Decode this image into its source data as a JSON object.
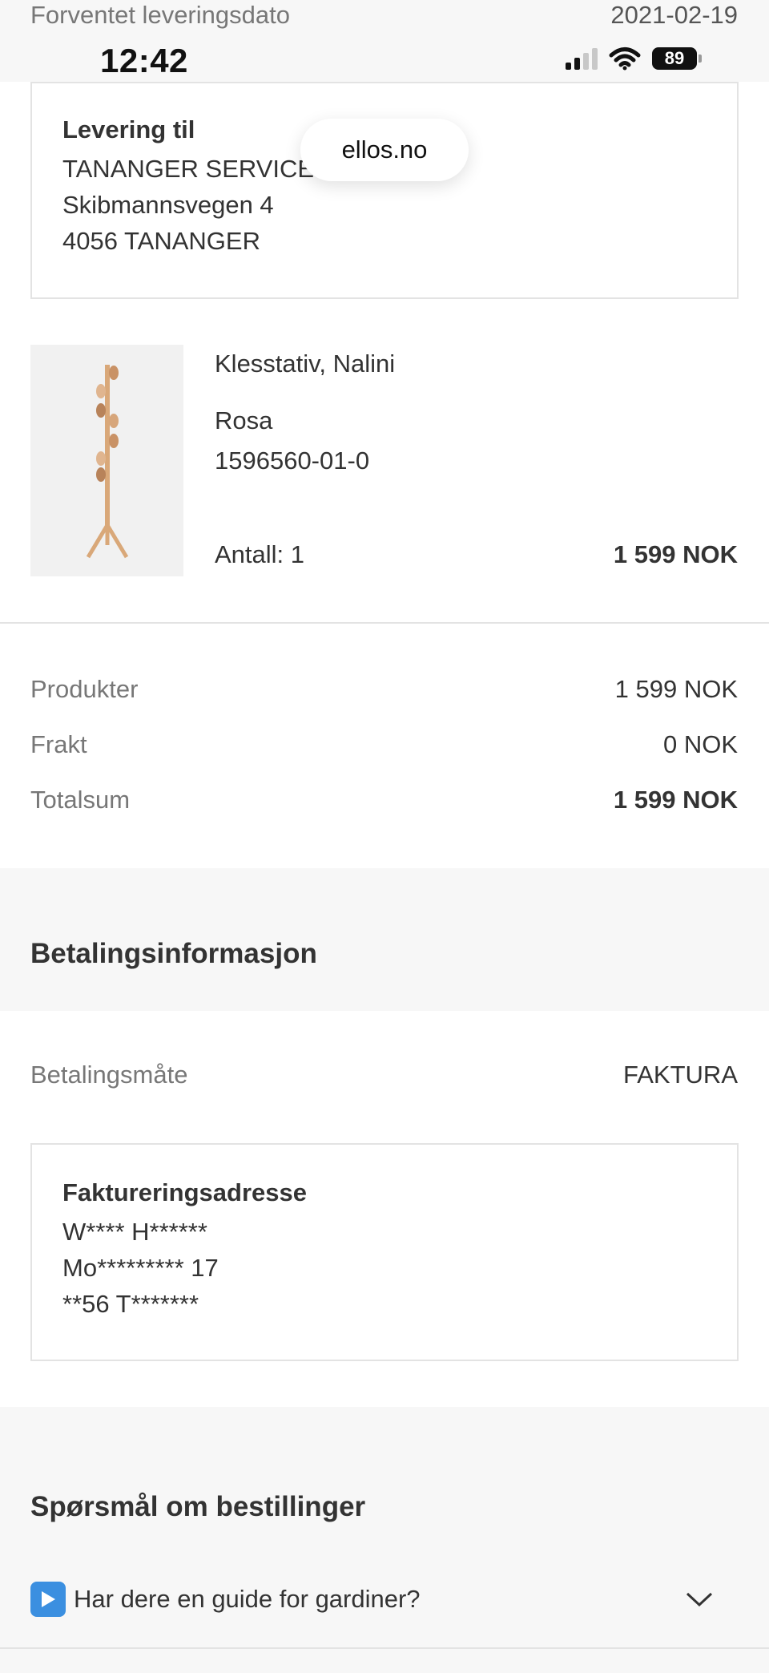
{
  "status_bar": {
    "time": "12:42",
    "battery": "89"
  },
  "delivery": {
    "date_label": "Forventet leveringsdato",
    "date_value": "2021-02-19"
  },
  "browser": {
    "domain": "ellos.no"
  },
  "shipping_address": {
    "heading": "Levering til",
    "lines": [
      "TANANGER SERVICE SENTER",
      "Skibmannsvegen 4",
      "4056 TANANGER"
    ]
  },
  "product": {
    "name": "Klesstativ, Nalini",
    "color": "Rosa",
    "sku": "1596560-01-0",
    "quantity": "Antall: 1",
    "price": "1 599 NOK",
    "image": "coat-rack-image"
  },
  "summary": [
    {
      "label": "Produkter",
      "value": "1 599 NOK"
    },
    {
      "label": "Frakt",
      "value": "0 NOK"
    },
    {
      "label": "Totalsum",
      "value": "1 599 NOK"
    }
  ],
  "payment": {
    "heading": "Betalingsinformasjon",
    "method_label": "Betalingsmåte",
    "method_value": "FAKTURA"
  },
  "billing_address": {
    "heading": "Faktureringsadresse",
    "lines": [
      "W**** H******",
      "Mo********* 17",
      "**56 T*******"
    ]
  },
  "faq": {
    "heading": "Spørsmål om bestillinger",
    "items": [
      {
        "icon": "play-button-icon",
        "question": "Har dere en guide for gardiner?"
      }
    ]
  },
  "colors": {
    "page_bg": "#ffffff",
    "section_bg": "#f7f7f7",
    "border": "#e3e3e3",
    "muted_text": "#777777"
  }
}
